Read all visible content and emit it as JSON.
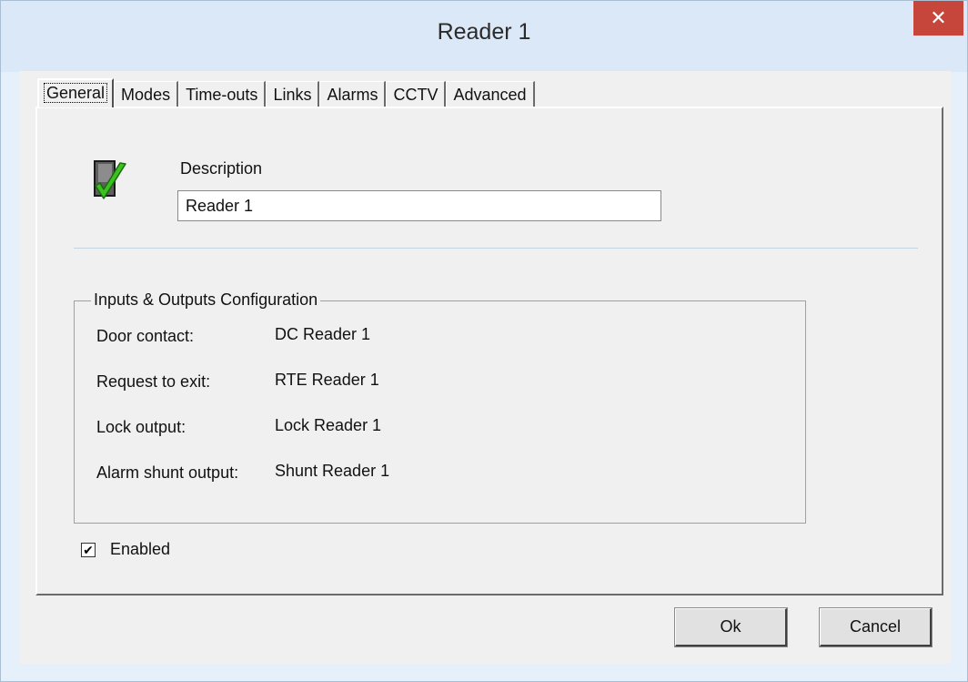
{
  "window": {
    "title": "Reader 1",
    "close_label": "✕"
  },
  "tabs": [
    {
      "label": "General",
      "active": true
    },
    {
      "label": "Modes",
      "active": false
    },
    {
      "label": "Time-outs",
      "active": false
    },
    {
      "label": "Links",
      "active": false
    },
    {
      "label": "Alarms",
      "active": false
    },
    {
      "label": "CCTV",
      "active": false
    },
    {
      "label": "Advanced",
      "active": false
    }
  ],
  "general": {
    "icon": "reader-check-icon",
    "description_label": "Description",
    "description_value": "Reader 1",
    "io_group": {
      "title": "Inputs & Outputs Configuration",
      "rows": [
        {
          "label": "Door contact:",
          "value": "DC Reader 1"
        },
        {
          "label": "Request to exit:",
          "value": "RTE Reader 1"
        },
        {
          "label": "Lock output:",
          "value": "Lock Reader 1"
        },
        {
          "label": "Alarm shunt output:",
          "value": "Shunt Reader 1"
        }
      ]
    },
    "enabled": {
      "label": "Enabled",
      "checked": true,
      "mark": "✔"
    }
  },
  "buttons": {
    "ok": "Ok",
    "cancel": "Cancel"
  },
  "colors": {
    "title_bar": "#dbe8f7",
    "close_button": "#c7463b",
    "dialog_face": "#f0f0f0",
    "check_green": "#3cc21e"
  }
}
